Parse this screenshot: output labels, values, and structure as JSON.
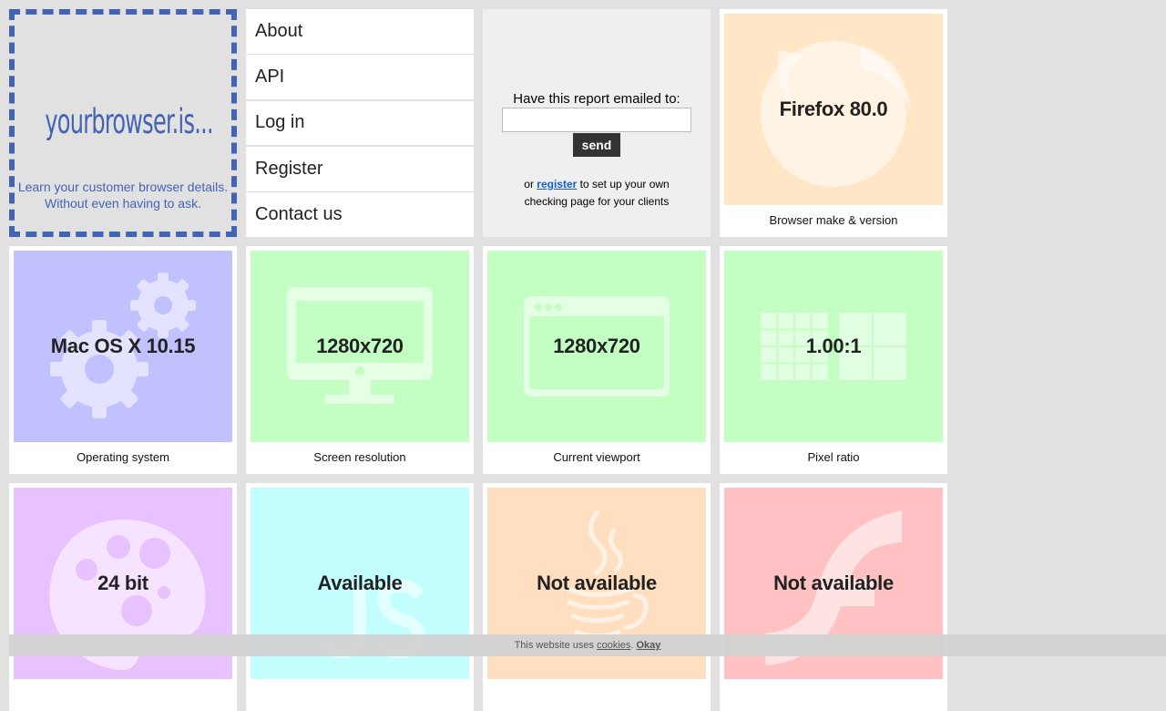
{
  "logo": {
    "wordmark": "yourbrowser.is...",
    "tagline_1": "Learn your customer browser details.",
    "tagline_2": "Without even having to ask."
  },
  "nav": [
    "About",
    "API",
    "Log in",
    "Register",
    "Contact us"
  ],
  "email_form": {
    "title": "Have this report emailed to:",
    "input_value": "",
    "send_label": "send",
    "note_prefix": "or",
    "note_link": "register",
    "note_suffix_1": "to set up your own",
    "note_suffix_2": "checking page for your clients"
  },
  "cards": {
    "browser": {
      "value": "Firefox 80.0",
      "label": "Browser make & version",
      "color": "#ffe6c6",
      "icon": "firefox-icon"
    },
    "os": {
      "value": "Mac OS X 10.15",
      "label": "Operating system",
      "color": "#c1c1ff",
      "icon": "gears-icon"
    },
    "screen": {
      "value": "1280x720",
      "label": "Screen resolution",
      "color": "#c3ffc3",
      "icon": "monitor-icon"
    },
    "viewport": {
      "value": "1280x720",
      "label": "Current viewport",
      "color": "#c3ffc3",
      "icon": "browser-window-icon"
    },
    "pixel": {
      "value": "1.00:1",
      "label": "Pixel ratio",
      "color": "#c3ffc3",
      "icon": "pixel-grid-icon"
    },
    "color": {
      "value": "24 bit",
      "label": "",
      "color": "#e8c2ff",
      "icon": "palette-icon"
    },
    "js": {
      "value": "Available",
      "label": "",
      "color": "#c3ffff",
      "icon": "javascript-icon"
    },
    "java": {
      "value": "Not available",
      "label": "",
      "color": "#ffdfc0",
      "icon": "java-cup-icon"
    },
    "flash": {
      "value": "Not available",
      "label": "",
      "color": "#ffc1c1",
      "icon": "flash-icon"
    }
  },
  "cookie_bar": {
    "text": "This website uses",
    "link": "cookies",
    "dot": ".",
    "okay": "Okay"
  }
}
